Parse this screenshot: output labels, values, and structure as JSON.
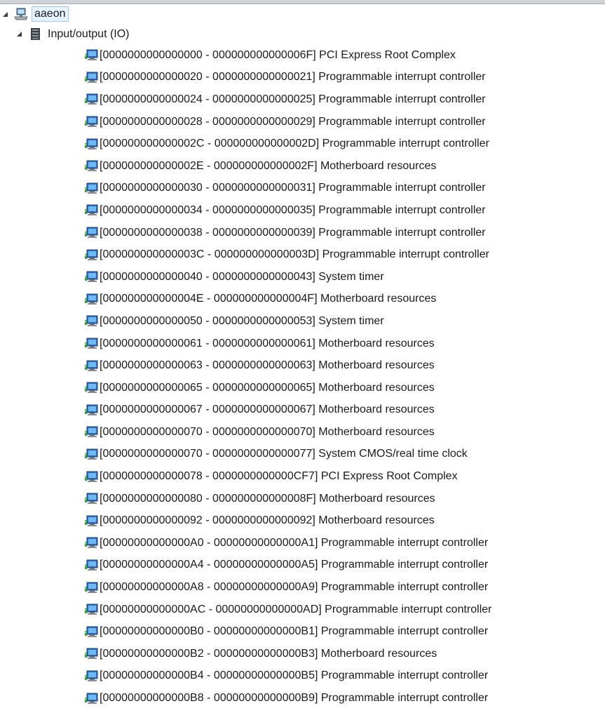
{
  "tree": {
    "root": {
      "label": "aaeon",
      "icon": "computer-icon",
      "expanded": true
    },
    "category": {
      "label": "Input/output (IO)",
      "icon": "io-chip-icon",
      "expanded": true
    },
    "device_icon": "device-monitor-icon",
    "items": [
      {
        "label": "[0000000000000000 - 000000000000006F]  PCI Express Root Complex"
      },
      {
        "label": "[0000000000000020 - 0000000000000021]  Programmable interrupt controller"
      },
      {
        "label": "[0000000000000024 - 0000000000000025]  Programmable interrupt controller"
      },
      {
        "label": "[0000000000000028 - 0000000000000029]  Programmable interrupt controller"
      },
      {
        "label": "[000000000000002C - 000000000000002D]  Programmable interrupt controller"
      },
      {
        "label": "[000000000000002E - 000000000000002F]  Motherboard resources"
      },
      {
        "label": "[0000000000000030 - 0000000000000031]  Programmable interrupt controller"
      },
      {
        "label": "[0000000000000034 - 0000000000000035]  Programmable interrupt controller"
      },
      {
        "label": "[0000000000000038 - 0000000000000039]  Programmable interrupt controller"
      },
      {
        "label": "[000000000000003C - 000000000000003D]  Programmable interrupt controller"
      },
      {
        "label": "[0000000000000040 - 0000000000000043]  System timer"
      },
      {
        "label": "[000000000000004E - 000000000000004F]  Motherboard resources"
      },
      {
        "label": "[0000000000000050 - 0000000000000053]  System timer"
      },
      {
        "label": "[0000000000000061 - 0000000000000061]  Motherboard resources"
      },
      {
        "label": "[0000000000000063 - 0000000000000063]  Motherboard resources"
      },
      {
        "label": "[0000000000000065 - 0000000000000065]  Motherboard resources"
      },
      {
        "label": "[0000000000000067 - 0000000000000067]  Motherboard resources"
      },
      {
        "label": "[0000000000000070 - 0000000000000070]  Motherboard resources"
      },
      {
        "label": "[0000000000000070 - 0000000000000077]  System CMOS/real time clock"
      },
      {
        "label": "[0000000000000078 - 0000000000000CF7]  PCI Express Root Complex"
      },
      {
        "label": "[0000000000000080 - 000000000000008F]  Motherboard resources"
      },
      {
        "label": "[0000000000000092 - 0000000000000092]  Motherboard resources"
      },
      {
        "label": "[00000000000000A0 - 00000000000000A1]  Programmable interrupt controller"
      },
      {
        "label": "[00000000000000A4 - 00000000000000A5]  Programmable interrupt controller"
      },
      {
        "label": "[00000000000000A8 - 00000000000000A9]  Programmable interrupt controller"
      },
      {
        "label": "[00000000000000AC - 00000000000000AD]  Programmable interrupt controller"
      },
      {
        "label": "[00000000000000B0 - 00000000000000B1]  Programmable interrupt controller"
      },
      {
        "label": "[00000000000000B2 - 00000000000000B3]  Motherboard resources"
      },
      {
        "label": "[00000000000000B4 - 00000000000000B5]  Programmable interrupt controller"
      },
      {
        "label": "[00000000000000B8 - 00000000000000B9]  Programmable interrupt controller"
      }
    ]
  }
}
